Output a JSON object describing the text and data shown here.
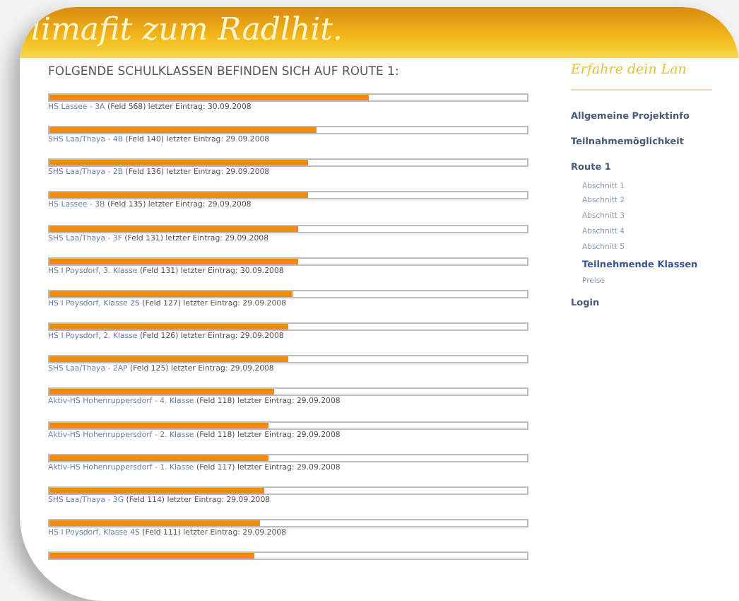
{
  "header": {
    "title": "limafit zum Radlhit."
  },
  "heading": "FOLGENDE SCHULKLASSEN BEFINDEN SICH AUF ROUTE 1:",
  "classes": [
    {
      "name": "HS Lassee - 3A",
      "detail": "(Feld 568) letzter Eintrag: 30.09.2008",
      "level": 0.67
    },
    {
      "name": "SHS Laa/Thaya - 4B",
      "detail": "(Feld 140) letzter Eintrag: 29.09.2008",
      "level": 0.56
    },
    {
      "name": "SHS Laa/Thaya - 2B",
      "detail": "(Feld 136) letzter Eintrag: 29.09.2008",
      "level": 0.54
    },
    {
      "name": "HS Lassee - 3B",
      "detail": "(Feld 135) letzter Eintrag: 29.09.2008",
      "level": 0.54
    },
    {
      "name": "SHS Laa/Thaya - 3F",
      "detail": "(Feld 131) letzter Eintrag: 29.09.2008",
      "level": 0.52
    },
    {
      "name": "HS I Poysdorf, 3. Klasse",
      "detail": "(Feld 131) letzter Eintrag: 30.09.2008",
      "level": 0.52
    },
    {
      "name": "HS I Poysdorf, Klasse 2S",
      "detail": "(Feld 127) letzter Eintrag: 29.09.2008",
      "level": 0.51
    },
    {
      "name": "HS I Poysdorf, 2. Klasse",
      "detail": "(Feld 126) letzter Eintrag: 29.09.2008",
      "level": 0.5
    },
    {
      "name": "SHS Laa/Thaya - 2AP",
      "detail": "(Feld 125) letzter Eintrag: 29.09.2008",
      "level": 0.5
    },
    {
      "name": "Aktiv-HS Hohenruppersdorf - 4. Klasse",
      "detail": "(Feld 118) letzter Eintrag: 29.09.2008",
      "level": 0.47
    },
    {
      "name": "Aktiv-HS Hohenruppersdorf - 2. Klasse",
      "detail": "(Feld 118) letzter Eintrag: 29.09.2008",
      "level": 0.46
    },
    {
      "name": "Aktiv-HS Hohenruppersdorf - 1. Klasse",
      "detail": "(Feld 117) letzter Eintrag: 29.09.2008",
      "level": 0.46
    },
    {
      "name": "SHS Laa/Thaya - 3G",
      "detail": "(Feld 114) letzter Eintrag: 29.09.2008",
      "level": 0.45
    },
    {
      "name": "HS I Poysdorf, Klasse 4S",
      "detail": "(Feld 111) letzter Eintrag: 29.09.2008",
      "level": 0.44
    },
    {
      "level": 0.43
    }
  ],
  "sidebar": {
    "title": "Erfahre dein Lan",
    "items": [
      {
        "label": "Allgemeine Projektinfo",
        "selected": false
      },
      {
        "label": "Teilnahmemöglichkeit",
        "selected": false
      },
      {
        "label": "Route 1",
        "selected": false,
        "children": [
          {
            "label": "Abschnitt 1",
            "selected": false
          },
          {
            "label": "Abschnitt 2",
            "selected": false
          },
          {
            "label": "Abschnitt 3",
            "selected": false
          },
          {
            "label": "Abschnitt 4",
            "selected": false
          },
          {
            "label": "Abschnitt 5",
            "selected": false
          },
          {
            "label": "Teilnehmende Klassen",
            "selected": true
          },
          {
            "label": "Preise",
            "selected": false
          }
        ]
      },
      {
        "label": "Login",
        "selected": false
      }
    ]
  }
}
